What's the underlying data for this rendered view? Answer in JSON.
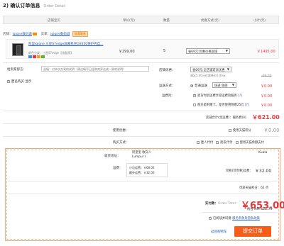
{
  "page": {
    "title": "2) 确认订单信息",
    "title_en": "Order Detail"
  },
  "table_header": {
    "col_store": "店铺宝贝",
    "col_price": "单价(元)",
    "col_qty": "数量",
    "col_discount": "优惠方式(元)",
    "col_subtotal": "小计(元)"
  },
  "seller": {
    "shop_label": "店铺：",
    "shop_name": "iqiqne数码城",
    "seller_label": "卖家：",
    "seller_name": "iqiqne数码城",
    "wangwang": "和我联系"
  },
  "item": {
    "title": "阿里iqiqne 三星S7edge屏幕机壳G9350保护壳自...",
    "attr": "颜色分类：三星S7edge【炫酷黑】",
    "price": "￥299.00",
    "quantity": "5",
    "discount_option": "省69元:优惠价格区域",
    "subtotal": "￥1495.00",
    "badge_colors": [
      "#3a8ee6",
      "#e4393c",
      "#f0a020",
      "#57b33e"
    ]
  },
  "message": {
    "label": "给卖家留言：",
    "placeholder": "选填：对本次交易的说明（建议填写已经和卖家达成一致的说明）"
  },
  "anonymous": {
    "label": "匿名购买",
    "suffix": "显示"
  },
  "store_discount": {
    "label": "店铺优惠：",
    "value": "省69元:全店铺可享优惠",
    "note": "满足5.00元优惠降价0.00元",
    "amount": "-69.00"
  },
  "shipping": {
    "label": "运送方式：",
    "option_label": "普通运送",
    "select_value": "快递 免邮",
    "amount": "0.00"
  },
  "insurance": {
    "label": "运费险：",
    "text": "退货时退运费享受运费险服务",
    "amount": "0.00"
  },
  "gift_card": {
    "text": "购买是附赠卡，是否使用附赠25元",
    "amount": "0.00"
  },
  "store_total": {
    "label": "店铺合计(含运费)：服务费(0)",
    "amount": "￥621.00"
  },
  "coupon": {
    "label": "使用优惠：",
    "checkbox_label": "使用天猫积分",
    "amount": "0.00"
  },
  "buyer_options": {
    "label": "购买方式：",
    "opt1": "匿人代付",
    "opt2": "朋友代付",
    "opt3": "使用天猫余额支付"
  },
  "address": {
    "section_label": "收货地址：",
    "name": "阿里里 收货人",
    "line": "Lumpur I",
    "country_code": "Kuala",
    "shipping_label": "运费：",
    "ship_fee1_label": "小包运费：",
    "ship_fee1": "68.00",
    "ship_fee2_label": "额外运费：",
    "ship_fee2": "32.00",
    "intl_fee_label": "国际运费：",
    "intl_fee_note": "完税(可宣重)运费：",
    "intl_fee": "￥32.00",
    "points_label": "可获天猫积分：",
    "points": "62",
    "points_unit": "点"
  },
  "pay": {
    "label": "实付款：",
    "label_en": "Order Total：",
    "amount": "653.00",
    "currency": "￥",
    "rate_note": "约合 RM 422.79",
    "agree_label": "已阅读并同意",
    "agree_link": "服务条款及隐私政策",
    "back_link": "返回购物车",
    "submit": "提交订单"
  }
}
